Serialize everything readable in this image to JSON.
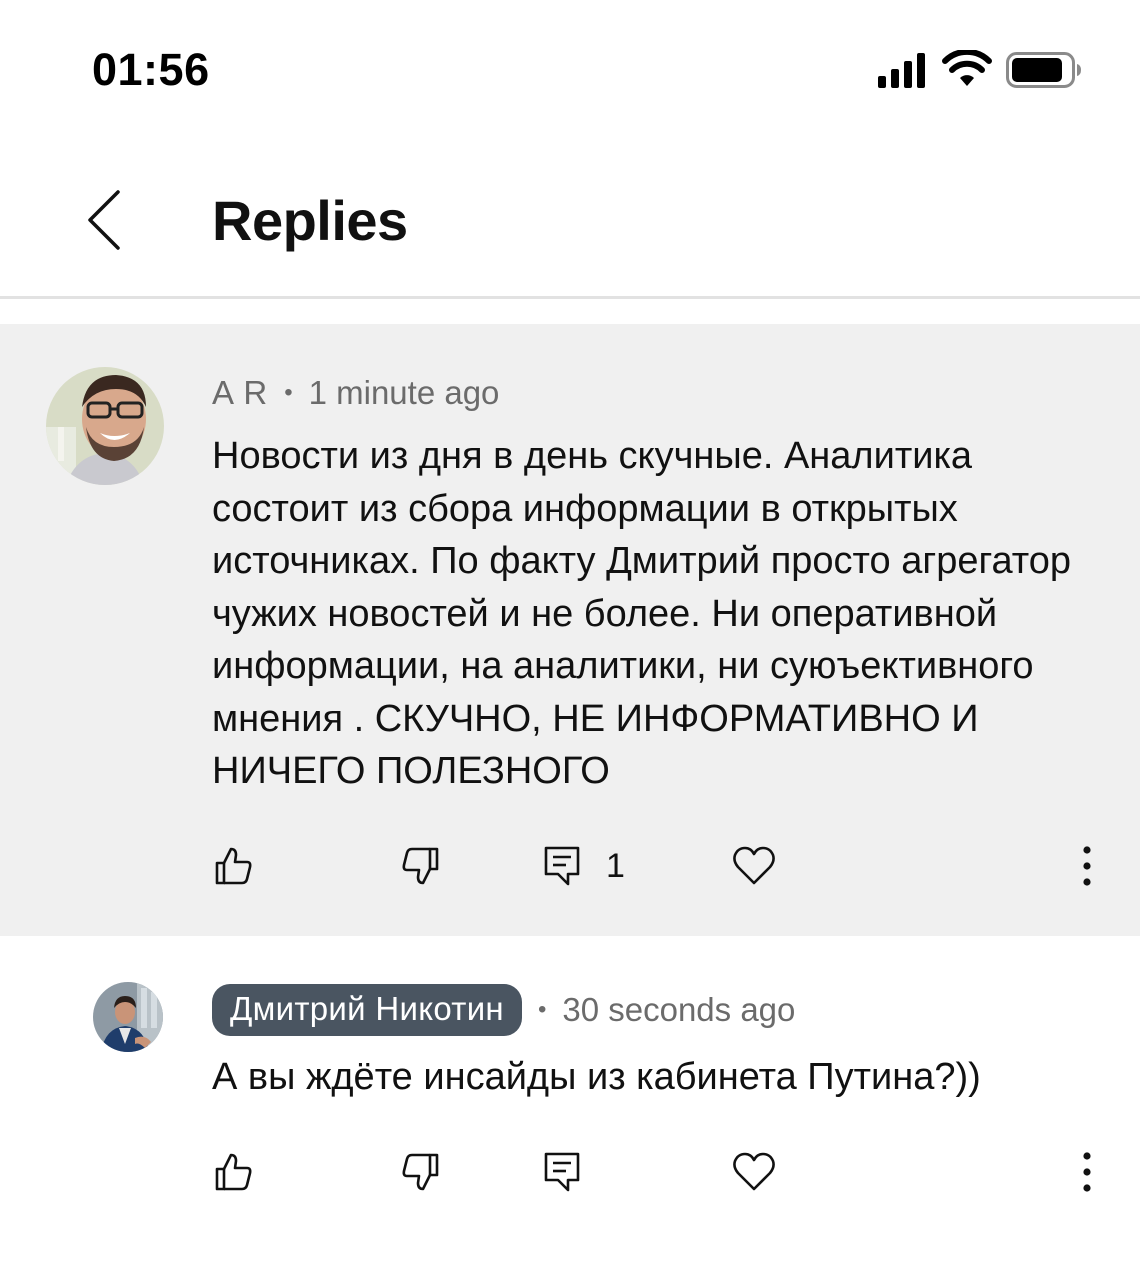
{
  "status_bar": {
    "time": "01:56",
    "icons": [
      "cellular-signal-icon",
      "wifi-icon",
      "battery-icon"
    ]
  },
  "header": {
    "back_icon": "chevron-left-icon",
    "title": "Replies"
  },
  "comments": [
    {
      "author": "A R",
      "time": "1 minute ago",
      "text": "Новости из дня в день скучные. Аналитика состоит из сбора информации в открытых источниках. По факту Дмитрий просто агрегатор чужих новостей и не более. Ни оперативной информации, на аналитики, ни суюъективного мнения . СКУЧНО, НЕ ИНФОРМАТИВНО И НИЧЕГО ПОЛЕЗНОГО",
      "reply_count": "1",
      "highlighted": true
    },
    {
      "author": "Дмитрий Никотин",
      "author_is_creator": true,
      "time": "30 seconds ago",
      "text": "А вы ждёте инсайды из кабинета Путина?))"
    }
  ],
  "separator": "•",
  "actions": [
    "thumbs-up-icon",
    "thumbs-down-icon",
    "reply-icon",
    "heart-icon",
    "more-vertical-icon"
  ],
  "colors": {
    "highlight_bg": "#f0f0f0",
    "badge_bg": "#4a5561",
    "meta_text": "#6b6b6b"
  }
}
